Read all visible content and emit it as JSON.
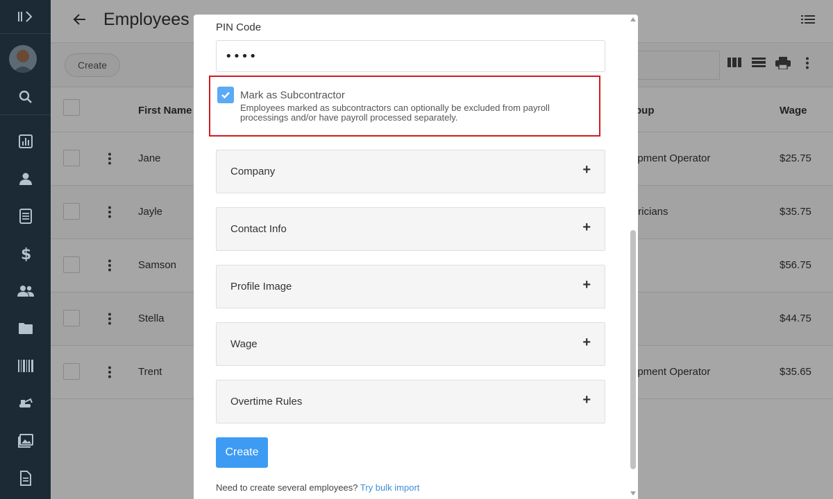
{
  "header": {
    "title": "Employees"
  },
  "toolbar": {
    "create_label": "Create"
  },
  "table": {
    "columns": [
      "First Name",
      "oup",
      "Wage"
    ],
    "rows": [
      {
        "first_name": "Jane",
        "group": "ipment Operator",
        "wage": "$25.75"
      },
      {
        "first_name": "Jayle",
        "group": "tricians",
        "wage": "$35.75"
      },
      {
        "first_name": "Samson",
        "group": "",
        "wage": "$56.75"
      },
      {
        "first_name": "Stella",
        "group": "",
        "wage": "$44.75"
      },
      {
        "first_name": "Trent",
        "group": "ipment Operator",
        "wage": "$35.65"
      }
    ]
  },
  "modal": {
    "pin_label": "PIN Code",
    "pin_value": "••••",
    "subcontractor": {
      "checked": true,
      "title": "Mark as Subcontractor",
      "description": "Employees marked as subcontractors can optionally be excluded from payroll processings and/or have payroll processed separately."
    },
    "sections": [
      {
        "label": "Company",
        "toggle": "+"
      },
      {
        "label": "Contact Info",
        "toggle": "+"
      },
      {
        "label": "Profile Image",
        "toggle": "+"
      },
      {
        "label": "Wage",
        "toggle": "+"
      },
      {
        "label": "Overtime Rules",
        "toggle": "+"
      }
    ],
    "create_label": "Create",
    "footnote_text": "Need to create several employees?",
    "footnote_link": "Try bulk import"
  },
  "colors": {
    "sidebar": "#1b2a35",
    "primary": "#3d9bf3",
    "highlight": "#d0191f",
    "checkbox": "#5aaaf5"
  }
}
